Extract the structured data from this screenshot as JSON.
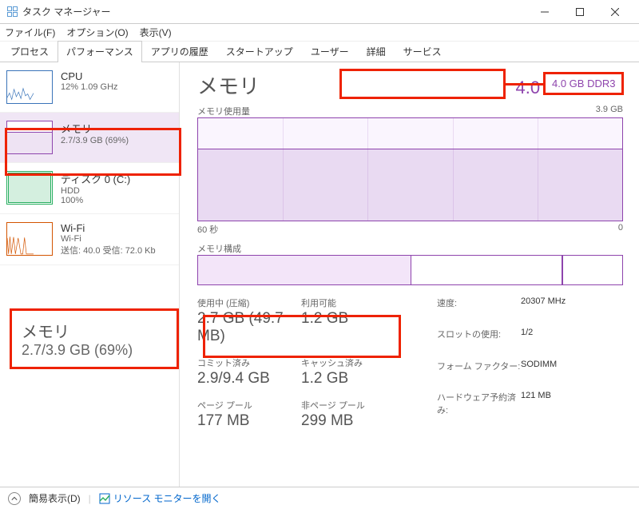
{
  "window": {
    "title": "タスク マネージャー"
  },
  "menu": {
    "file": "ファイル(F)",
    "options": "オプション(O)",
    "view": "表示(V)"
  },
  "tabs": {
    "processes": "プロセス",
    "performance": "パフォーマンス",
    "app_history": "アプリの履歴",
    "startup": "スタートアップ",
    "users": "ユーザー",
    "details": "詳細",
    "services": "サービス"
  },
  "sidebar": {
    "cpu": {
      "name": "CPU",
      "sub": "12%  1.09 GHz"
    },
    "memory": {
      "name": "メモリ",
      "sub": "2.7/3.9 GB (69%)"
    },
    "disk": {
      "name": "ディスク 0 (C:)",
      "sub1": "HDD",
      "sub2": "100%"
    },
    "wifi": {
      "name": "Wi-Fi",
      "sub1": "Wi-Fi",
      "sub2": "送信: 40.0 受信: 72.0 Kb"
    }
  },
  "main": {
    "title": "メモリ",
    "spec": "4.0 GB DDR3",
    "chart1_label": "メモリ使用量",
    "chart1_max": "3.9 GB",
    "axis_left": "60 秒",
    "axis_right": "0",
    "comp_label": "メモリ構成",
    "stats": {
      "in_use_label": "使用中 (圧縮)",
      "in_use_value": "2.7 GB (49.7 MB)",
      "available_label": "利用可能",
      "available_value": "1.2 GB",
      "committed_label": "コミット済み",
      "committed_value": "2.9/9.4 GB",
      "cached_label": "キャッシュ済み",
      "cached_value": "1.2 GB",
      "paged_label": "ページ プール",
      "paged_value": "177 MB",
      "nonpaged_label": "非ページ プール",
      "nonpaged_value": "299 MB"
    },
    "meta": {
      "speed_label": "速度:",
      "speed_value": "20307 MHz",
      "slots_label": "スロットの使用:",
      "slots_value": "1/2",
      "form_label": "フォーム ファクター:",
      "form_value": "SODIMM",
      "reserved_label": "ハードウェア予約済み:",
      "reserved_value": "121 MB"
    }
  },
  "annotations": {
    "zoom_memory_title": "メモリ",
    "zoom_memory_sub": "2.7/3.9 GB (69%)",
    "zoom_spec": "4.0 GB DDR3"
  },
  "footer": {
    "simple_view": "簡易表示(D)",
    "open_monitor": "リソース モニターを開く"
  }
}
